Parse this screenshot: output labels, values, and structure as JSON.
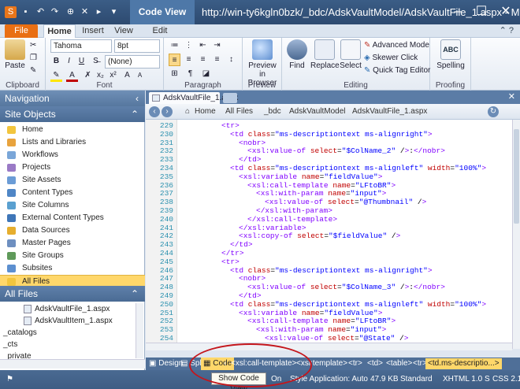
{
  "titlebar": {
    "context_tab": "Code View Tools",
    "title": "http://win-ty6kgln0bzk/_bdc/AdskVaultModel/AdskVaultFile_1.aspx - M..."
  },
  "ribbon_tabs": [
    "File",
    "Home",
    "Insert",
    "View",
    "Edit"
  ],
  "ribbon": {
    "clipboard": {
      "paste": "Paste",
      "label": "Clipboard"
    },
    "font": {
      "name": "Tahoma",
      "size": "8pt",
      "style": "(None)",
      "label": "Font"
    },
    "paragraph": {
      "label": "Paragraph"
    },
    "preview": {
      "button": "Preview in Browser",
      "label": "Preview"
    },
    "editing": {
      "find": "Find",
      "replace": "Replace",
      "select": "Select",
      "advanced": "Advanced Mode",
      "skewer": "Skewer Click",
      "quicktag": "Quick Tag Editor",
      "label": "Editing"
    },
    "proofing": {
      "spelling": "Spelling",
      "abc": "ABC",
      "label": "Proofing"
    }
  },
  "nav": {
    "title": "Navigation",
    "site_objects_title": "Site Objects",
    "site_objects": [
      "Home",
      "Lists and Libraries",
      "Workflows",
      "Projects",
      "Site Assets",
      "Content Types",
      "Site Columns",
      "External Content Types",
      "Data Sources",
      "Master Pages",
      "Site Groups",
      "Subsites",
      "All Files"
    ],
    "selected": "All Files",
    "all_files_title": "All Files",
    "files": [
      "AdskVaultFile_1.aspx",
      "AdskVaultItem_1.aspx"
    ],
    "folders": [
      "_catalogs",
      "_cts",
      "_private"
    ]
  },
  "doc_tab": "AdskVaultFile_1.aspx",
  "breadcrumbs": [
    "Home",
    "All Files",
    "_bdc",
    "AdskVaultModel",
    "AdskVaultFile_1.aspx"
  ],
  "code_lines": [
    {
      "n": "229",
      "text": "<tr>"
    },
    {
      "n": "230",
      "text": "<td class=\"ms-descriptiontext ms-alignright\">"
    },
    {
      "n": "231",
      "text": "<nobr>"
    },
    {
      "n": "232",
      "text": "<xsl:value-of select=\"$ColName_2\" />:</nobr>"
    },
    {
      "n": "233",
      "text": "</td>"
    },
    {
      "n": "234",
      "text": "<td class=\"ms-descriptiontext ms-alignleft\" width=\"100%\">"
    },
    {
      "n": "235",
      "text": "<xsl:variable name=\"fieldValue\">"
    },
    {
      "n": "236",
      "text": "<xsl:call-template name=\"LFtoBR\">"
    },
    {
      "n": "237",
      "text": "<xsl:with-param name=\"input\">"
    },
    {
      "n": "238",
      "text": "<xsl:value-of select=\"@Thumbnail\" />"
    },
    {
      "n": "239",
      "text": "</xsl:with-param>"
    },
    {
      "n": "240",
      "text": "</xsl:call-template>"
    },
    {
      "n": "241",
      "text": "</xsl:variable>"
    },
    {
      "n": "242",
      "text": "<xsl:copy-of select=\"$fieldValue\" />"
    },
    {
      "n": "243",
      "text": "</td>"
    },
    {
      "n": "244",
      "text": "</tr>"
    },
    {
      "n": "245",
      "text": "<tr>"
    },
    {
      "n": "246",
      "text": "<td class=\"ms-descriptiontext ms-alignright\">"
    },
    {
      "n": "247",
      "text": "<nobr>"
    },
    {
      "n": "248",
      "text": "<xsl:value-of select=\"$ColName_3\" />:</nobr>"
    },
    {
      "n": "249",
      "text": "</td>"
    },
    {
      "n": "250",
      "text": "<td class=\"ms-descriptiontext ms-alignleft\" width=\"100%\">"
    },
    {
      "n": "251",
      "text": "<xsl:variable name=\"fieldValue\">"
    },
    {
      "n": "252",
      "text": "<xsl:call-template name=\"LFtoBR\">"
    },
    {
      "n": "253",
      "text": "<xsl:with-param name=\"input\">"
    },
    {
      "n": "254",
      "text": "<xsl:value-of select=\"@State\" />"
    }
  ],
  "viewbar": {
    "design": "Design",
    "split": "Split",
    "code": "Code",
    "tags": [
      "<xsl:call-template>",
      "<xsl:template>",
      "<tr>",
      "<td>",
      "<table>",
      "<tr>",
      "<td.ms-descriptio...>"
    ]
  },
  "status": {
    "tooltip": "Show Code View",
    "on": "On",
    "style": "Style Application: Auto",
    "size": "47.9 KB",
    "mode": "Standard",
    "xhtml": "XHTML 1.0 S",
    "css": "CSS 2.1"
  }
}
